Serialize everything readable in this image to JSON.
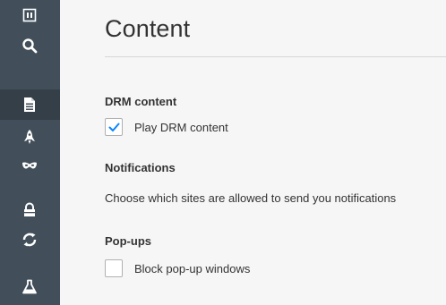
{
  "sidebar": {
    "items": [
      {
        "icon": "tabs-icon"
      },
      {
        "icon": "search-icon"
      },
      {
        "icon": "content-icon",
        "selected": true
      },
      {
        "icon": "applications-icon"
      },
      {
        "icon": "privacy-mask-icon"
      },
      {
        "icon": "security-lock-icon"
      },
      {
        "icon": "sync-icon"
      },
      {
        "icon": "advanced-flask-icon"
      }
    ]
  },
  "page": {
    "title": "Content"
  },
  "drm": {
    "heading": "DRM content",
    "checkbox_label": "Play DRM content",
    "checked": true
  },
  "notifications": {
    "heading": "Notifications",
    "description": "Choose which sites are allowed to send you notifications"
  },
  "popups": {
    "heading": "Pop-ups",
    "checkbox_label": "Block pop-up windows",
    "checked": false
  },
  "colors": {
    "sidebar_bg": "#424f5a",
    "sidebar_selected": "#343f48",
    "check_accent": "#0a84ff"
  }
}
